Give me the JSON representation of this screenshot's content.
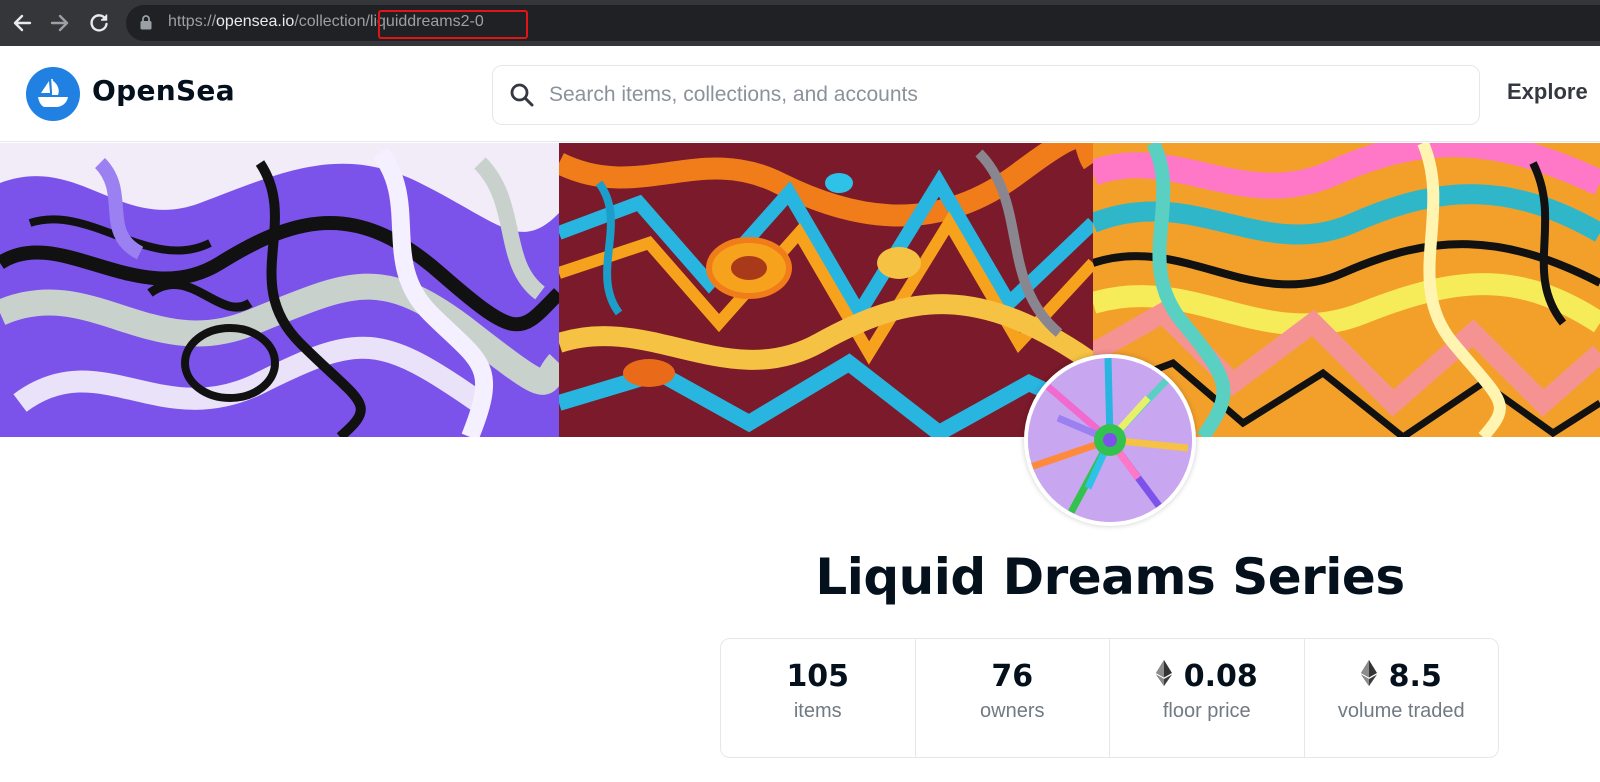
{
  "browser": {
    "url_scheme": "https://",
    "url_host": "opensea.io",
    "url_path": "/collection/",
    "url_slug": "liquiddreams2-0",
    "highlight_color": "#e01515"
  },
  "header": {
    "brand": "OpenSea",
    "brand_color": "#2081e2",
    "search_placeholder": "Search items, collections, and accounts",
    "nav_explore": "Explore"
  },
  "collection": {
    "title": "Liquid Dreams Series",
    "stats": [
      {
        "value": "105",
        "label": "items",
        "eth": false
      },
      {
        "value": "76",
        "label": "owners",
        "eth": false
      },
      {
        "value": "0.08",
        "label": "floor price",
        "eth": true
      },
      {
        "value": "8.5",
        "label": "volume traded",
        "eth": true
      }
    ]
  },
  "icons": {
    "back": "back-arrow-icon",
    "forward": "forward-arrow-icon",
    "reload": "reload-icon",
    "lock": "lock-icon",
    "search": "search-icon",
    "logo": "opensea-logo-icon",
    "eth": "ethereum-icon"
  }
}
